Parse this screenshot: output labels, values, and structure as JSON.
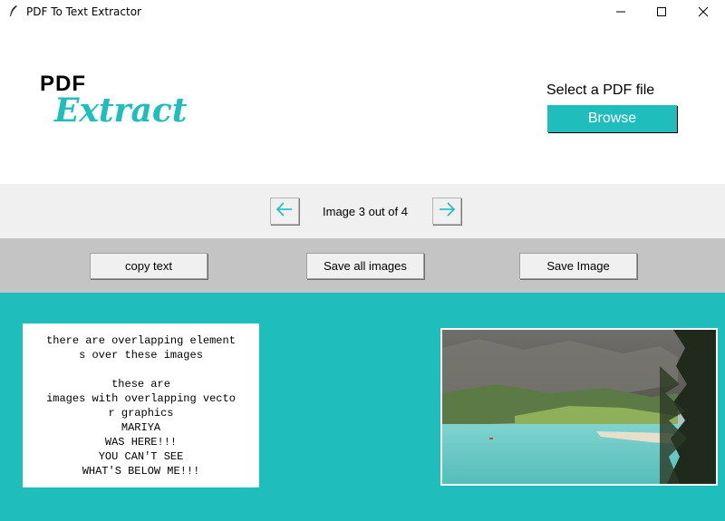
{
  "window": {
    "title": "PDF To Text Extractor"
  },
  "logo": {
    "line1": "PDF",
    "line2": "Extract"
  },
  "file": {
    "select_label": "Select a PDF file",
    "browse_label": "Browse"
  },
  "navigation": {
    "status": "Image 3 out of 4"
  },
  "actions": {
    "copy_text": "copy text",
    "save_all_images": "Save all images",
    "save_image": "Save Image"
  },
  "extracted_text": {
    "lines": [
      "there are overlapping element",
      "s over these images",
      "",
      "these are",
      "images with overlapping vecto",
      "r graphics",
      "MARIYA",
      "WAS HERE!!!",
      "YOU CAN'T SEE",
      "WHAT'S BELOW ME!!!"
    ]
  },
  "colors": {
    "accent": "#20bdbd",
    "nav_band": "#f0f0f0",
    "button_band": "#c4c4c4"
  },
  "icons": {
    "app": "feather-icon",
    "minimize": "minimize-icon",
    "maximize": "maximize-icon",
    "close": "close-icon",
    "prev": "arrow-left-icon",
    "next": "arrow-right-icon"
  }
}
